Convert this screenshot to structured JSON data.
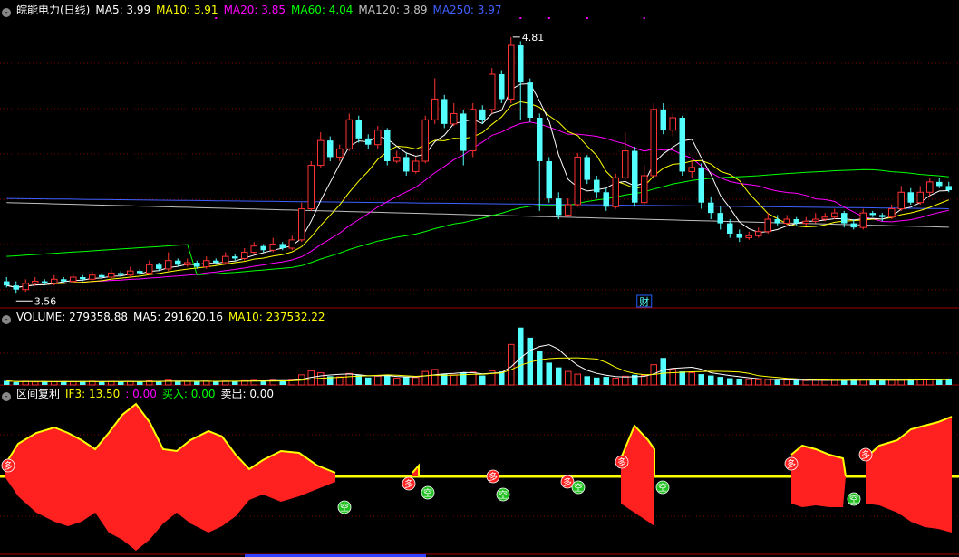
{
  "header1": {
    "title": "皖能电力(日线)",
    "items": [
      {
        "label": "MA5: 3.99",
        "color": "#ffffff"
      },
      {
        "label": "MA10: 3.91",
        "color": "#ffff00"
      },
      {
        "label": "MA20: 3.85",
        "color": "#ff00ff"
      },
      {
        "label": "MA60: 4.04",
        "color": "#00ff00"
      },
      {
        "label": "MA120: 3.89",
        "color": "#c0c0c0"
      },
      {
        "label": "MA250: 3.97",
        "color": "#4060ff"
      }
    ]
  },
  "header2": {
    "label": "VOLUME: 279358.88",
    "ma5": "MA5: 291620.16",
    "ma10": "MA10: 237532.22"
  },
  "header3": {
    "name": "区间复利",
    "if3": "IF3: 13.50",
    "v": ": 0.00",
    "buy": "买入: 0.00",
    "sell": "卖出: 0.00"
  },
  "annotations": {
    "high_label": "4.81",
    "low_label": "3.56",
    "cai": "财",
    "duo": "多",
    "kong": "空"
  },
  "colors": {
    "up": "#ff3232",
    "down": "#54ffff",
    "grid": "#800000",
    "signal": "#ffff00"
  },
  "chart_data": [
    {
      "type": "candlestick",
      "ylim": [
        3.5,
        4.9
      ],
      "candles": [
        [
          3.62,
          3.6,
          3.64,
          3.59
        ],
        [
          3.6,
          3.58,
          3.62,
          3.56
        ],
        [
          3.58,
          3.61,
          3.63,
          3.57
        ],
        [
          3.61,
          3.62,
          3.64,
          3.6
        ],
        [
          3.62,
          3.61,
          3.63,
          3.6
        ],
        [
          3.61,
          3.63,
          3.65,
          3.6
        ],
        [
          3.63,
          3.62,
          3.64,
          3.61
        ],
        [
          3.62,
          3.64,
          3.66,
          3.61
        ],
        [
          3.64,
          3.63,
          3.65,
          3.62
        ],
        [
          3.63,
          3.65,
          3.67,
          3.62
        ],
        [
          3.65,
          3.64,
          3.66,
          3.63
        ],
        [
          3.64,
          3.66,
          3.68,
          3.63
        ],
        [
          3.66,
          3.65,
          3.67,
          3.64
        ],
        [
          3.65,
          3.67,
          3.69,
          3.64
        ],
        [
          3.67,
          3.66,
          3.68,
          3.65
        ],
        [
          3.66,
          3.7,
          3.72,
          3.65
        ],
        [
          3.7,
          3.68,
          3.71,
          3.67
        ],
        [
          3.68,
          3.72,
          3.76,
          3.67
        ],
        [
          3.72,
          3.7,
          3.73,
          3.69
        ],
        [
          3.7,
          3.71,
          3.73,
          3.69
        ],
        [
          3.71,
          3.69,
          3.72,
          3.68
        ],
        [
          3.69,
          3.72,
          3.74,
          3.68
        ],
        [
          3.72,
          3.71,
          3.73,
          3.7
        ],
        [
          3.71,
          3.74,
          3.76,
          3.7
        ],
        [
          3.74,
          3.73,
          3.75,
          3.72
        ],
        [
          3.73,
          3.76,
          3.78,
          3.72
        ],
        [
          3.76,
          3.79,
          3.81,
          3.75
        ],
        [
          3.79,
          3.77,
          3.8,
          3.76
        ],
        [
          3.77,
          3.8,
          3.83,
          3.76
        ],
        [
          3.8,
          3.78,
          3.81,
          3.77
        ],
        [
          3.78,
          3.82,
          3.84,
          3.77
        ],
        [
          3.82,
          3.97,
          4.0,
          3.81
        ],
        [
          3.97,
          4.18,
          4.2,
          3.96
        ],
        [
          4.18,
          4.3,
          4.34,
          4.17
        ],
        [
          4.3,
          4.22,
          4.32,
          4.2
        ],
        [
          4.22,
          4.26,
          4.28,
          4.2
        ],
        [
          4.26,
          4.4,
          4.43,
          4.25
        ],
        [
          4.4,
          4.31,
          4.42,
          4.29
        ],
        [
          4.31,
          4.28,
          4.33,
          4.26
        ],
        [
          4.28,
          4.35,
          4.37,
          4.26
        ],
        [
          4.35,
          4.2,
          4.36,
          4.18
        ],
        [
          4.2,
          4.22,
          4.25,
          4.19
        ],
        [
          4.22,
          4.15,
          4.24,
          4.13
        ],
        [
          4.15,
          4.2,
          4.22,
          4.14
        ],
        [
          4.2,
          4.4,
          4.42,
          4.19
        ],
        [
          4.4,
          4.5,
          4.6,
          4.38
        ],
        [
          4.5,
          4.38,
          4.52,
          4.36
        ],
        [
          4.38,
          4.43,
          4.48,
          4.37
        ],
        [
          4.43,
          4.25,
          4.45,
          4.18
        ],
        [
          4.25,
          4.45,
          4.48,
          4.22
        ],
        [
          4.45,
          4.4,
          4.47,
          4.38
        ],
        [
          4.45,
          4.62,
          4.65,
          4.43
        ],
        [
          4.62,
          4.5,
          4.64,
          4.48
        ],
        [
          4.5,
          4.76,
          4.8,
          4.48
        ],
        [
          4.76,
          4.58,
          4.78,
          4.4
        ],
        [
          4.58,
          4.41,
          4.6,
          4.39
        ],
        [
          4.41,
          4.2,
          4.43,
          3.96
        ],
        [
          4.2,
          4.02,
          4.22,
          4.0
        ],
        [
          4.02,
          3.94,
          4.05,
          3.92
        ],
        [
          3.94,
          3.99,
          4.02,
          3.93
        ],
        [
          3.99,
          4.22,
          4.24,
          3.98
        ],
        [
          4.22,
          4.11,
          4.23,
          4.09
        ],
        [
          4.11,
          4.05,
          4.13,
          4.02
        ],
        [
          4.05,
          3.98,
          4.07,
          3.96
        ],
        [
          3.98,
          4.12,
          4.14,
          3.97
        ],
        [
          4.12,
          4.25,
          4.34,
          4.11
        ],
        [
          4.25,
          4.0,
          4.27,
          3.98
        ],
        [
          4.0,
          4.13,
          4.18,
          3.99
        ],
        [
          4.13,
          4.45,
          4.48,
          4.12
        ],
        [
          4.45,
          4.35,
          4.48,
          4.33
        ],
        [
          4.35,
          4.41,
          4.43,
          4.32
        ],
        [
          4.41,
          4.15,
          4.42,
          4.13
        ],
        [
          4.15,
          4.17,
          4.2,
          4.12
        ],
        [
          4.17,
          4.0,
          4.19,
          3.97
        ],
        [
          4.0,
          3.95,
          4.03,
          3.92
        ],
        [
          3.95,
          3.9,
          3.98,
          3.87
        ],
        [
          3.9,
          3.85,
          3.92,
          3.83
        ],
        [
          3.85,
          3.83,
          3.87,
          3.81
        ],
        [
          3.83,
          3.84,
          3.86,
          3.82
        ],
        [
          3.84,
          3.86,
          3.88,
          3.83
        ],
        [
          3.86,
          3.92,
          3.95,
          3.85
        ],
        [
          3.92,
          3.9,
          3.94,
          3.89
        ],
        [
          3.9,
          3.92,
          3.94,
          3.89
        ],
        [
          3.92,
          3.9,
          3.93,
          3.89
        ],
        [
          3.9,
          3.91,
          3.93,
          3.89
        ],
        [
          3.91,
          3.92,
          3.95,
          3.9
        ],
        [
          3.92,
          3.93,
          3.95,
          3.91
        ],
        [
          3.93,
          3.95,
          3.97,
          3.92
        ],
        [
          3.95,
          3.9,
          3.96,
          3.88
        ],
        [
          3.9,
          3.88,
          3.92,
          3.87
        ],
        [
          3.88,
          3.95,
          3.97,
          3.87
        ],
        [
          3.95,
          3.94,
          3.96,
          3.93
        ],
        [
          3.94,
          3.93,
          3.95,
          3.91
        ],
        [
          3.93,
          3.97,
          3.99,
          3.92
        ],
        [
          3.97,
          4.05,
          4.08,
          3.96
        ],
        [
          4.05,
          4.0,
          4.07,
          3.99
        ],
        [
          4.0,
          4.05,
          4.08,
          3.99
        ],
        [
          4.05,
          4.1,
          4.12,
          4.03
        ],
        [
          4.1,
          4.08,
          4.12,
          4.07
        ],
        [
          4.08,
          4.06,
          4.1,
          4.05
        ]
      ]
    },
    {
      "type": "bar",
      "ylim": [
        0,
        900000
      ],
      "values": [
        60000,
        40000,
        55000,
        45000,
        50000,
        48000,
        52000,
        46000,
        50000,
        55000,
        48000,
        52000,
        50000,
        54000,
        47000,
        60000,
        50000,
        70000,
        55000,
        52000,
        48000,
        56000,
        50000,
        58000,
        55000,
        62000,
        68000,
        60000,
        70000,
        62000,
        72000,
        150000,
        210000,
        180000,
        130000,
        120000,
        170000,
        150000,
        110000,
        130000,
        140000,
        100000,
        120000,
        110000,
        200000,
        230000,
        160000,
        150000,
        180000,
        190000,
        140000,
        210000,
        200000,
        600000,
        850000,
        700000,
        500000,
        330000,
        260000,
        200000,
        160000,
        130000,
        110000,
        120000,
        100000,
        130000,
        150000,
        140000,
        300000,
        400000,
        230000,
        200000,
        180000,
        160000,
        140000,
        120000,
        100000,
        90000,
        80000,
        75000,
        80000,
        70000,
        72000,
        68000,
        65000,
        70000,
        66000,
        70000,
        72000,
        80000,
        75000,
        70000,
        73000,
        68000,
        72000,
        80000,
        75000,
        85000,
        90000,
        95000
      ]
    }
  ]
}
